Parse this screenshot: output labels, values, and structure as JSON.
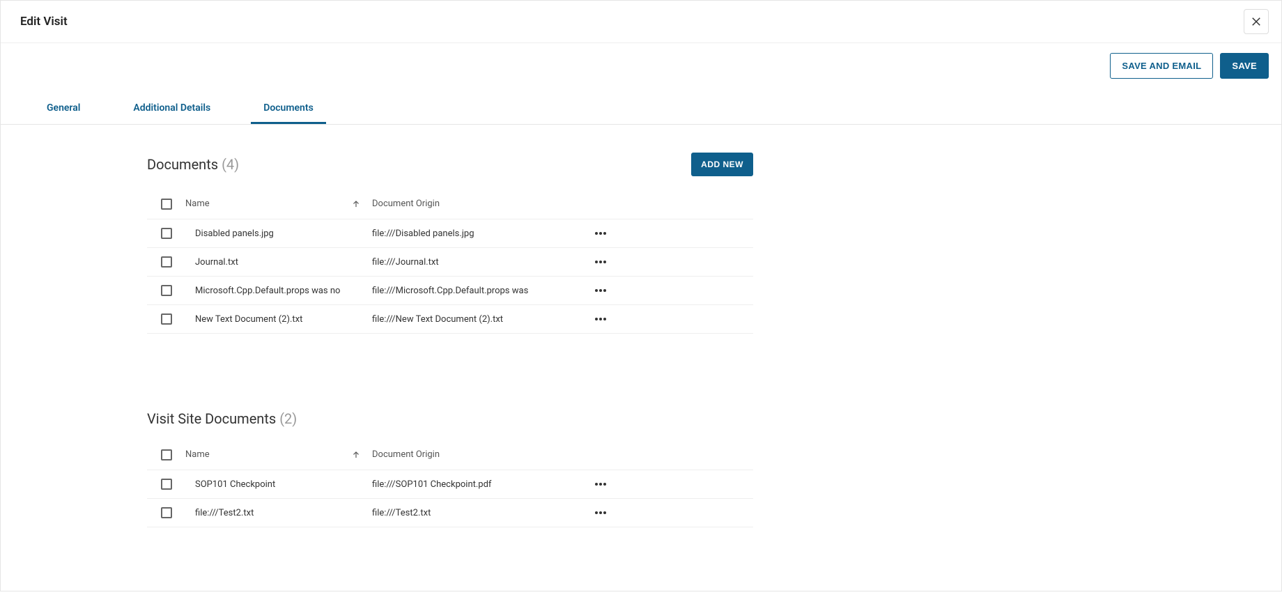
{
  "modal": {
    "title": "Edit Visit"
  },
  "actions": {
    "save_and_email": "SAVE AND EMAIL",
    "save": "SAVE"
  },
  "tabs": {
    "general": "General",
    "additional_details": "Additional Details",
    "documents": "Documents"
  },
  "documents_section": {
    "title": "Documents",
    "count": "(4)",
    "add_new_label": "ADD NEW",
    "columns": {
      "name": "Name",
      "origin": "Document Origin"
    },
    "rows": [
      {
        "name": "Disabled panels.jpg",
        "origin": "file:///Disabled panels.jpg"
      },
      {
        "name": "Journal.txt",
        "origin": "file:///Journal.txt"
      },
      {
        "name": "Microsoft.Cpp.Default.props was no",
        "origin": "file:///Microsoft.Cpp.Default.props was"
      },
      {
        "name": "New Text Document (2).txt",
        "origin": "file:///New Text Document (2).txt"
      }
    ]
  },
  "visit_site_section": {
    "title": "Visit Site Documents",
    "count": "(2)",
    "columns": {
      "name": "Name",
      "origin": "Document Origin"
    },
    "rows": [
      {
        "name": "SOP101 Checkpoint",
        "origin": "file:///SOP101 Checkpoint.pdf"
      },
      {
        "name": "file:///Test2.txt",
        "origin": "file:///Test2.txt"
      }
    ]
  }
}
